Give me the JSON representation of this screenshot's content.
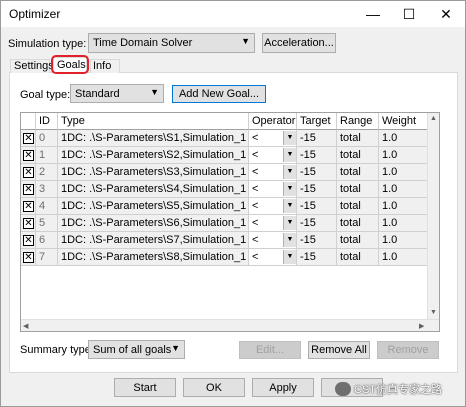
{
  "window": {
    "title": "Optimizer",
    "minimize": "—",
    "maximize": "☐",
    "close": "✕"
  },
  "simulation": {
    "label": "Simulation type:",
    "value": "Time Domain Solver",
    "acceleration_label": "Acceleration..."
  },
  "tabs": [
    {
      "label": "Settings"
    },
    {
      "label": "Goals"
    },
    {
      "label": "Info"
    }
  ],
  "active_tab": "Goals",
  "goal_type": {
    "label": "Goal type:",
    "value": "Standard",
    "add_label": "Add New Goal..."
  },
  "table": {
    "headers": [
      "ID",
      "Type",
      "Operator",
      "Target",
      "Range",
      "Weight"
    ],
    "rows": [
      {
        "checked": true,
        "id": "0",
        "type": "1DC: .\\S-Parameters\\S1,Simulation_1",
        "operator": "<",
        "target": "-15",
        "range": "total",
        "weight": "1.0"
      },
      {
        "checked": true,
        "id": "1",
        "type": "1DC: .\\S-Parameters\\S2,Simulation_1",
        "operator": "<",
        "target": "-15",
        "range": "total",
        "weight": "1.0"
      },
      {
        "checked": true,
        "id": "2",
        "type": "1DC: .\\S-Parameters\\S3,Simulation_1",
        "operator": "<",
        "target": "-15",
        "range": "total",
        "weight": "1.0"
      },
      {
        "checked": true,
        "id": "3",
        "type": "1DC: .\\S-Parameters\\S4,Simulation_1",
        "operator": "<",
        "target": "-15",
        "range": "total",
        "weight": "1.0"
      },
      {
        "checked": true,
        "id": "4",
        "type": "1DC: .\\S-Parameters\\S5,Simulation_1",
        "operator": "<",
        "target": "-15",
        "range": "total",
        "weight": "1.0"
      },
      {
        "checked": true,
        "id": "5",
        "type": "1DC: .\\S-Parameters\\S6,Simulation_1",
        "operator": "<",
        "target": "-15",
        "range": "total",
        "weight": "1.0"
      },
      {
        "checked": true,
        "id": "6",
        "type": "1DC: .\\S-Parameters\\S7,Simulation_1",
        "operator": "<",
        "target": "-15",
        "range": "total",
        "weight": "1.0"
      },
      {
        "checked": true,
        "id": "7",
        "type": "1DC: .\\S-Parameters\\S8,Simulation_1",
        "operator": "<",
        "target": "-15",
        "range": "total",
        "weight": "1.0"
      }
    ]
  },
  "summary": {
    "label": "Summary type:",
    "value": "Sum of all goals"
  },
  "actions": {
    "edit": "Edit...",
    "remove_all": "Remove All",
    "remove": "Remove"
  },
  "footer": {
    "start": "Start",
    "ok": "OK",
    "apply": "Apply"
  },
  "watermark": {
    "text": "CST仿真专家之路"
  },
  "colors": {
    "highlight": "#e0202a",
    "accent": "#0078d7"
  }
}
